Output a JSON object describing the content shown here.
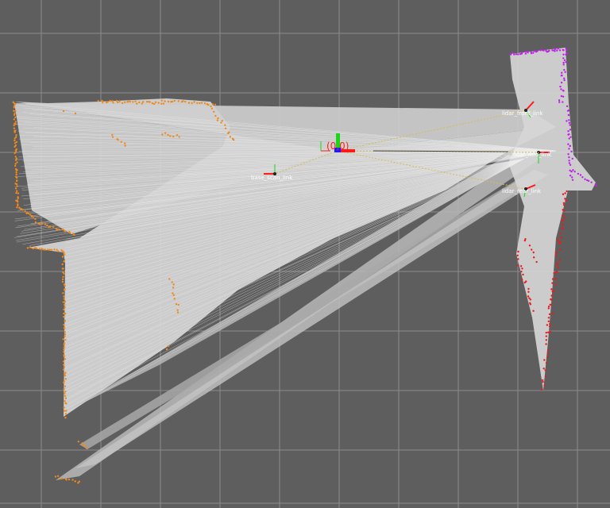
{
  "view": {
    "background": "#5e5e5e",
    "grid_color": "#8c8c8c",
    "scan_fill": "#d8d8d8",
    "scan_edge": "#eeeeee",
    "colors": {
      "scan_orange": "#f08a1c",
      "scan_magenta": "#c020e8",
      "scan_red": "#ee1a1a",
      "axis_x": "#ff1a1a",
      "axis_y": "#18d818",
      "axis_z": "#1a1aff",
      "tf_link": "#d0c050"
    }
  },
  "origin": {
    "label": "(0,0)",
    "icon": "origin-axes-icon"
  },
  "frames": [
    {
      "id": "frame-left",
      "label": "base_scan_link"
    },
    {
      "id": "frame-top-right",
      "label": "lidar_front_link"
    },
    {
      "id": "frame-mid-right",
      "label": "lidar_mid_link"
    },
    {
      "id": "frame-bottom-right",
      "label": "lidar_rear_link"
    }
  ]
}
